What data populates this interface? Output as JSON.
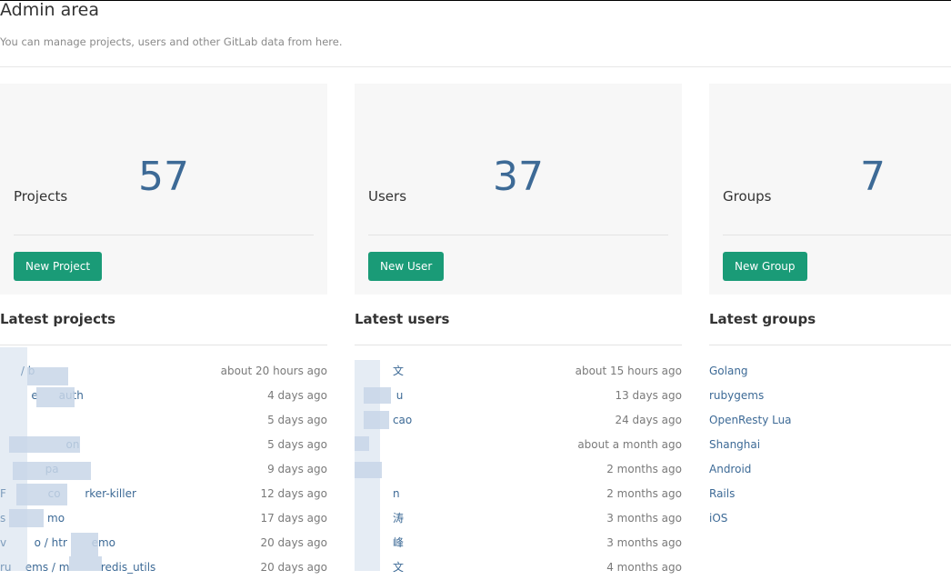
{
  "header": {
    "title": "Admin area",
    "subtitle": "You can manage projects, users and other GitLab data from here."
  },
  "cards": [
    {
      "title": "Projects",
      "count": "57",
      "button": "New Project"
    },
    {
      "title": "Users",
      "count": "37",
      "button": "New User"
    },
    {
      "title": "Groups",
      "count": "7",
      "button": "New Group"
    }
  ],
  "latest_projects": {
    "title": "Latest projects",
    "rows": [
      {
        "name": "      / b",
        "time": "about 20 hours ago"
      },
      {
        "name": "         e      auth",
        "time": "4 days ago"
      },
      {
        "name": " ",
        "time": "5 days ago"
      },
      {
        "name": "                   on",
        "time": "5 days ago"
      },
      {
        "name": "             pa",
        "time": "9 days ago"
      },
      {
        "name": "F            co       rker-killer",
        "time": "12 days ago"
      },
      {
        "name": "s            mo",
        "time": "17 days ago"
      },
      {
        "name": "v        o / htr       emo",
        "time": "20 days ago"
      },
      {
        "name": "ru    ems / m         redis_utils",
        "time": "20 days ago"
      }
    ]
  },
  "latest_users": {
    "title": "Latest users",
    "rows": [
      {
        "name": "           文",
        "time": "about 15 hours ago"
      },
      {
        "name": "            u",
        "time": "13 days ago"
      },
      {
        "name": "           cao",
        "time": "24 days ago"
      },
      {
        "name": " ",
        "time": "about a month ago"
      },
      {
        "name": " ",
        "time": "2 months ago"
      },
      {
        "name": "           n",
        "time": "2 months ago"
      },
      {
        "name": "           涛",
        "time": "3 months ago"
      },
      {
        "name": "           峰",
        "time": "3 months ago"
      },
      {
        "name": "           文",
        "time": "4 months ago"
      }
    ]
  },
  "latest_groups": {
    "title": "Latest groups",
    "rows": [
      {
        "name": "Golang"
      },
      {
        "name": "rubygems"
      },
      {
        "name": "OpenResty Lua"
      },
      {
        "name": "Shanghai"
      },
      {
        "name": "Android"
      },
      {
        "name": "Rails"
      },
      {
        "name": "iOS"
      }
    ]
  },
  "colors": {
    "accent_button": "#1a9b77",
    "link": "#3d6a96",
    "count": "#3d6a96",
    "card_background": "#f7f7f7"
  }
}
